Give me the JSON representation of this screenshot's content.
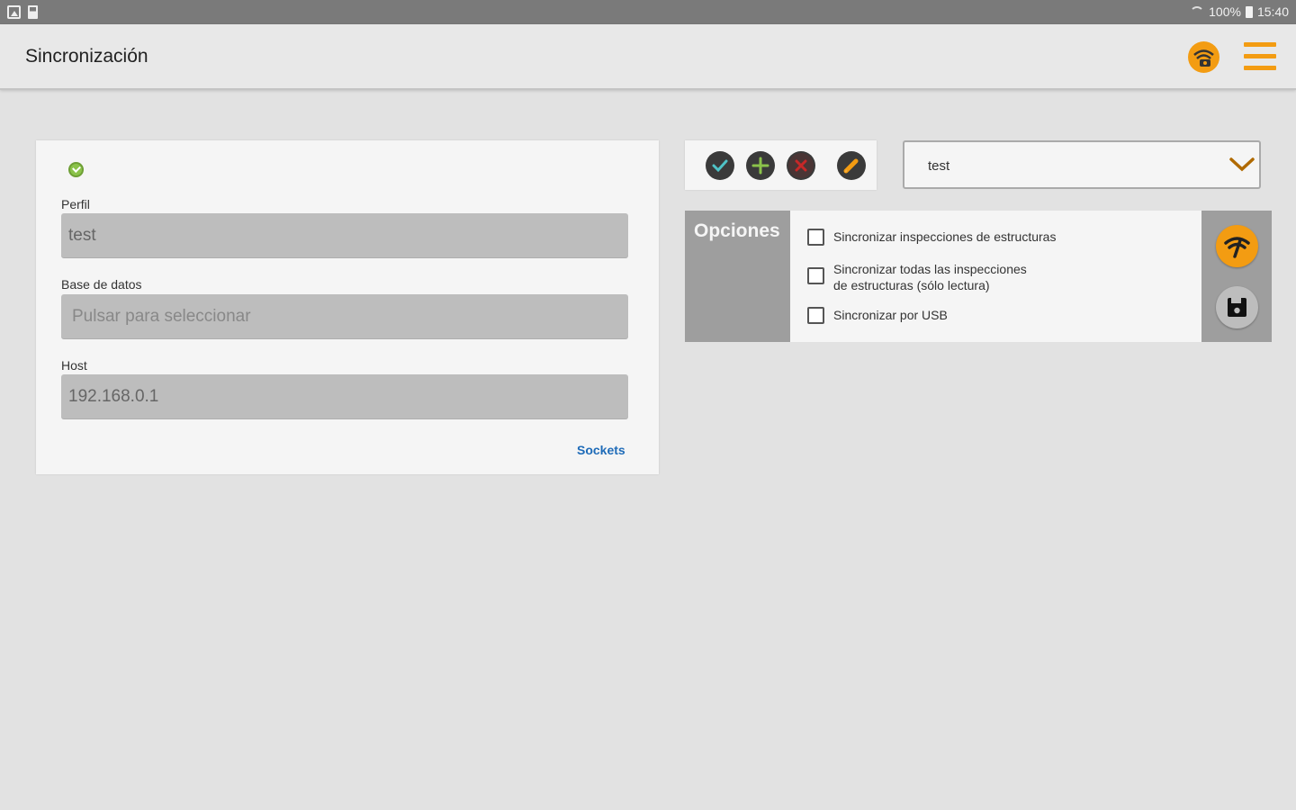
{
  "status_bar": {
    "battery": "100%",
    "time": "15:40"
  },
  "app_bar": {
    "title": "Sincronización"
  },
  "profile_form": {
    "perfil_label": "Perfil",
    "perfil_value": "test",
    "database_label": "Base de datos",
    "database_placeholder": "Pulsar para seleccionar",
    "host_label": "Host",
    "host_value": "192.168.0.1",
    "sockets_link": "Sockets"
  },
  "profile_dropdown": {
    "selected": "test"
  },
  "options": {
    "header": "Opciones",
    "items": [
      {
        "label": "Sincronizar inspecciones de estructuras",
        "checked": false
      },
      {
        "label": "Sincronizar todas las inspecciones",
        "label_line2": "de estructuras (sólo lectura)",
        "checked": false
      },
      {
        "label": "Sincronizar por USB",
        "checked": false
      }
    ]
  },
  "colors": {
    "accent": "#f39c12",
    "link": "#1e6bb8",
    "panel_header": "#9e9e9e",
    "field_bg": "#bdbdbd",
    "check_green": "#8bc34a"
  },
  "icons": {
    "toolbar": [
      "confirm-icon",
      "add-icon",
      "delete-icon",
      "edit-icon"
    ],
    "appbar": [
      "wifi-sync-icon",
      "menu-icon"
    ],
    "side": [
      "sync-wifi-icon",
      "save-floppy-icon"
    ]
  }
}
